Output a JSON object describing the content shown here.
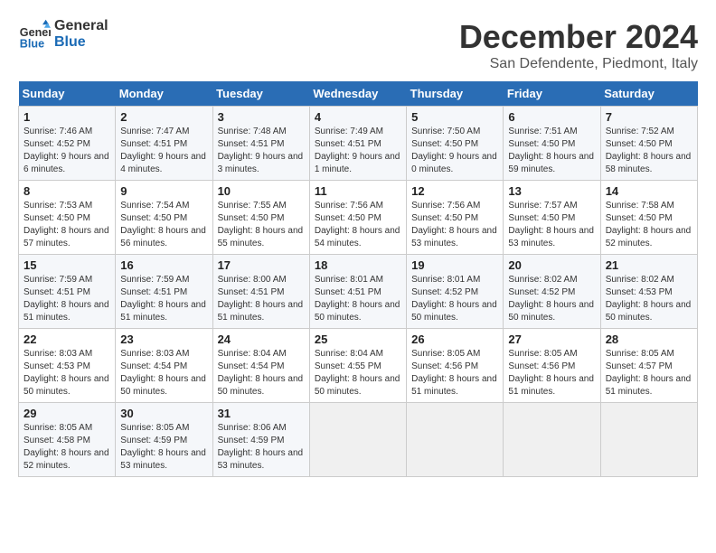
{
  "header": {
    "logo_line1": "General",
    "logo_line2": "Blue",
    "title": "December 2024",
    "subtitle": "San Defendente, Piedmont, Italy"
  },
  "weekdays": [
    "Sunday",
    "Monday",
    "Tuesday",
    "Wednesday",
    "Thursday",
    "Friday",
    "Saturday"
  ],
  "weeks": [
    [
      {
        "day": "1",
        "sunrise": "7:46 AM",
        "sunset": "4:52 PM",
        "daylight": "9 hours and 6 minutes."
      },
      {
        "day": "2",
        "sunrise": "7:47 AM",
        "sunset": "4:51 PM",
        "daylight": "9 hours and 4 minutes."
      },
      {
        "day": "3",
        "sunrise": "7:48 AM",
        "sunset": "4:51 PM",
        "daylight": "9 hours and 3 minutes."
      },
      {
        "day": "4",
        "sunrise": "7:49 AM",
        "sunset": "4:51 PM",
        "daylight": "9 hours and 1 minute."
      },
      {
        "day": "5",
        "sunrise": "7:50 AM",
        "sunset": "4:50 PM",
        "daylight": "9 hours and 0 minutes."
      },
      {
        "day": "6",
        "sunrise": "7:51 AM",
        "sunset": "4:50 PM",
        "daylight": "8 hours and 59 minutes."
      },
      {
        "day": "7",
        "sunrise": "7:52 AM",
        "sunset": "4:50 PM",
        "daylight": "8 hours and 58 minutes."
      }
    ],
    [
      {
        "day": "8",
        "sunrise": "7:53 AM",
        "sunset": "4:50 PM",
        "daylight": "8 hours and 57 minutes."
      },
      {
        "day": "9",
        "sunrise": "7:54 AM",
        "sunset": "4:50 PM",
        "daylight": "8 hours and 56 minutes."
      },
      {
        "day": "10",
        "sunrise": "7:55 AM",
        "sunset": "4:50 PM",
        "daylight": "8 hours and 55 minutes."
      },
      {
        "day": "11",
        "sunrise": "7:56 AM",
        "sunset": "4:50 PM",
        "daylight": "8 hours and 54 minutes."
      },
      {
        "day": "12",
        "sunrise": "7:56 AM",
        "sunset": "4:50 PM",
        "daylight": "8 hours and 53 minutes."
      },
      {
        "day": "13",
        "sunrise": "7:57 AM",
        "sunset": "4:50 PM",
        "daylight": "8 hours and 53 minutes."
      },
      {
        "day": "14",
        "sunrise": "7:58 AM",
        "sunset": "4:50 PM",
        "daylight": "8 hours and 52 minutes."
      }
    ],
    [
      {
        "day": "15",
        "sunrise": "7:59 AM",
        "sunset": "4:51 PM",
        "daylight": "8 hours and 51 minutes."
      },
      {
        "day": "16",
        "sunrise": "7:59 AM",
        "sunset": "4:51 PM",
        "daylight": "8 hours and 51 minutes."
      },
      {
        "day": "17",
        "sunrise": "8:00 AM",
        "sunset": "4:51 PM",
        "daylight": "8 hours and 51 minutes."
      },
      {
        "day": "18",
        "sunrise": "8:01 AM",
        "sunset": "4:51 PM",
        "daylight": "8 hours and 50 minutes."
      },
      {
        "day": "19",
        "sunrise": "8:01 AM",
        "sunset": "4:52 PM",
        "daylight": "8 hours and 50 minutes."
      },
      {
        "day": "20",
        "sunrise": "8:02 AM",
        "sunset": "4:52 PM",
        "daylight": "8 hours and 50 minutes."
      },
      {
        "day": "21",
        "sunrise": "8:02 AM",
        "sunset": "4:53 PM",
        "daylight": "8 hours and 50 minutes."
      }
    ],
    [
      {
        "day": "22",
        "sunrise": "8:03 AM",
        "sunset": "4:53 PM",
        "daylight": "8 hours and 50 minutes."
      },
      {
        "day": "23",
        "sunrise": "8:03 AM",
        "sunset": "4:54 PM",
        "daylight": "8 hours and 50 minutes."
      },
      {
        "day": "24",
        "sunrise": "8:04 AM",
        "sunset": "4:54 PM",
        "daylight": "8 hours and 50 minutes."
      },
      {
        "day": "25",
        "sunrise": "8:04 AM",
        "sunset": "4:55 PM",
        "daylight": "8 hours and 50 minutes."
      },
      {
        "day": "26",
        "sunrise": "8:05 AM",
        "sunset": "4:56 PM",
        "daylight": "8 hours and 51 minutes."
      },
      {
        "day": "27",
        "sunrise": "8:05 AM",
        "sunset": "4:56 PM",
        "daylight": "8 hours and 51 minutes."
      },
      {
        "day": "28",
        "sunrise": "8:05 AM",
        "sunset": "4:57 PM",
        "daylight": "8 hours and 51 minutes."
      }
    ],
    [
      {
        "day": "29",
        "sunrise": "8:05 AM",
        "sunset": "4:58 PM",
        "daylight": "8 hours and 52 minutes."
      },
      {
        "day": "30",
        "sunrise": "8:05 AM",
        "sunset": "4:59 PM",
        "daylight": "8 hours and 53 minutes."
      },
      {
        "day": "31",
        "sunrise": "8:06 AM",
        "sunset": "4:59 PM",
        "daylight": "8 hours and 53 minutes."
      },
      null,
      null,
      null,
      null
    ]
  ]
}
